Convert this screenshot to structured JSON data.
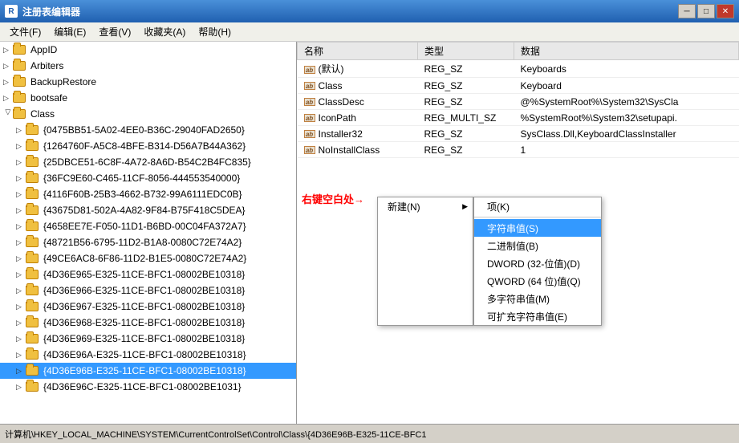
{
  "titleBar": {
    "icon": "R",
    "title": "注册表编辑器",
    "minimizeLabel": "─",
    "maximizeLabel": "□",
    "closeLabel": "✕"
  },
  "menuBar": {
    "items": [
      {
        "label": "文件(F)"
      },
      {
        "label": "编辑(E)"
      },
      {
        "label": "查看(V)"
      },
      {
        "label": "收藏夹(A)"
      },
      {
        "label": "帮助(H)"
      }
    ]
  },
  "leftPanel": {
    "items": [
      {
        "label": "AppID",
        "indent": 0
      },
      {
        "label": "Arbiters",
        "indent": 0
      },
      {
        "label": "BackupRestore",
        "indent": 0
      },
      {
        "label": "bootsafe",
        "indent": 0
      },
      {
        "label": "Class",
        "indent": 0
      },
      {
        "label": "{0475BB51-5A02-4EE0-B36C-29040FAD2650}",
        "indent": 1
      },
      {
        "label": "{1264760F-A5C8-4BFE-B314-D56A7B44A362}",
        "indent": 1
      },
      {
        "label": "{25DBCE51-6C8F-4A72-8A6D-B54C2B4FC835}",
        "indent": 1
      },
      {
        "label": "{36FC9E60-C465-11CF-8056-444553540000}",
        "indent": 1
      },
      {
        "label": "{4116F60B-25B3-4662-B732-99A6111EDC0B}",
        "indent": 1
      },
      {
        "label": "{43675D81-502A-4A82-9F84-B75F418C5DEA}",
        "indent": 1
      },
      {
        "label": "{4658EE7E-F050-11D1-B6BD-00C04FA372A7}",
        "indent": 1
      },
      {
        "label": "{48721B56-6795-11D2-B1A8-0080C72E74A2}",
        "indent": 1
      },
      {
        "label": "{49CE6AC8-6F86-11D2-B1E5-0080C72E74A2}",
        "indent": 1
      },
      {
        "label": "{4D36E965-E325-11CE-BFC1-08002BE10318}",
        "indent": 1
      },
      {
        "label": "{4D36E966-E325-11CE-BFC1-08002BE10318}",
        "indent": 1
      },
      {
        "label": "{4D36E967-E325-11CE-BFC1-08002BE10318}",
        "indent": 1
      },
      {
        "label": "{4D36E968-E325-11CE-BFC1-08002BE10318}",
        "indent": 1
      },
      {
        "label": "{4D36E969-E325-11CE-BFC1-08002BE10318}",
        "indent": 1
      },
      {
        "label": "{4D36E96A-E325-11CE-BFC1-08002BE10318}",
        "indent": 1
      },
      {
        "label": "{4D36E96B-E325-11CE-BFC1-08002BE10318}",
        "indent": 1
      },
      {
        "label": "{4D36E96C-E325-11CE-BFC1-08002BE1031}",
        "indent": 1
      }
    ]
  },
  "rightPanel": {
    "columns": [
      "名称",
      "类型",
      "数据"
    ],
    "rows": [
      {
        "name": "(默认)",
        "type": "REG_SZ",
        "data": "Keyboards"
      },
      {
        "name": "Class",
        "type": "REG_SZ",
        "data": "Keyboard"
      },
      {
        "name": "ClassDesc",
        "type": "REG_SZ",
        "data": "@%SystemRoot%\\System32\\SysCla"
      },
      {
        "name": "IconPath",
        "type": "REG_MULTI_SZ",
        "data": "%SystemRoot%\\System32\\setupapi."
      },
      {
        "name": "Installer32",
        "type": "REG_SZ",
        "data": "SysClass.Dll,KeyboardClassInstaller"
      },
      {
        "name": "NoInstallClass",
        "type": "REG_SZ",
        "data": "1"
      }
    ]
  },
  "annotation": {
    "text": "右键空白处",
    "arrow": "→"
  },
  "contextMenu": {
    "newLabel": "新建(N)",
    "subArrow": "▶",
    "items": [
      {
        "label": "项(K)"
      },
      {
        "label": "字符串值(S)",
        "highlighted": true
      },
      {
        "label": "二进制值(B)"
      },
      {
        "label": "DWORD (32-位值)(D)"
      },
      {
        "label": "QWORD (64 位)值(Q)"
      },
      {
        "label": "多字符串值(M)"
      },
      {
        "label": "可扩充字符串值(E)"
      }
    ]
  },
  "statusBar": {
    "text": "计算机\\HKEY_LOCAL_MACHINE\\SYSTEM\\CurrentControlSet\\Control\\Class\\{4D36E96B-E325-11CE-BFC1"
  }
}
